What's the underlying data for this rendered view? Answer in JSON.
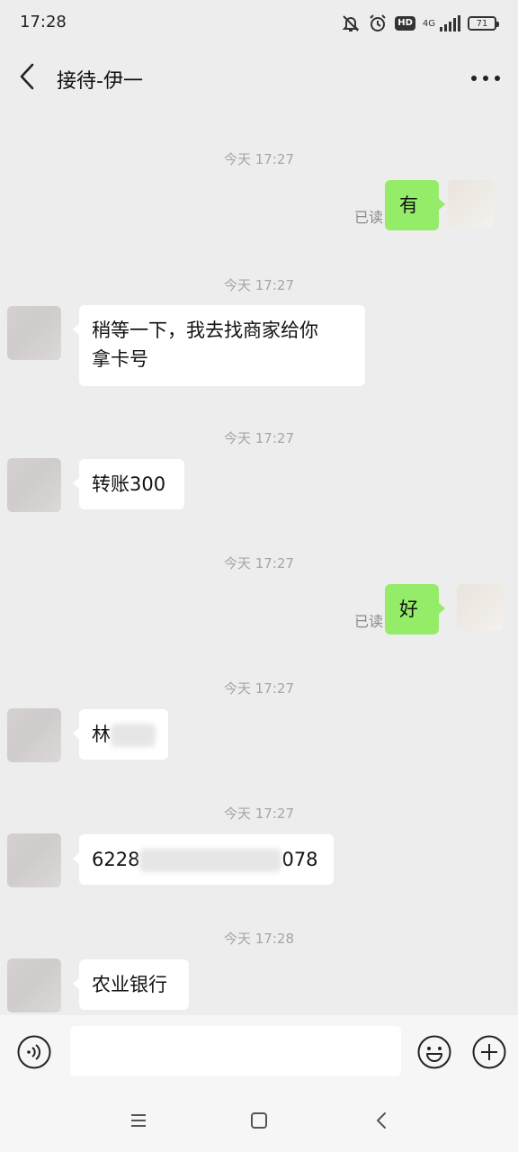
{
  "status_bar": {
    "time": "17:28",
    "network": "4G",
    "battery": "71",
    "icons": [
      "mute-icon",
      "alarm-icon",
      "hd-icon",
      "signal-icon",
      "battery-icon"
    ]
  },
  "header": {
    "title": "接待-伊一",
    "back_icon": "chevron-left-icon",
    "more_icon": "more-dots-icon"
  },
  "messages": [
    {
      "time": "今天 17:27",
      "side": "right",
      "text": "有",
      "read": "已读"
    },
    {
      "time": "今天 17:27",
      "side": "left",
      "line1": "稍等一下，我去找商家给你",
      "line2": "拿卡号"
    },
    {
      "time": "今天 17:27",
      "side": "left",
      "text": "转账300"
    },
    {
      "time": "今天 17:27",
      "side": "right",
      "text": "好",
      "read": "已读"
    },
    {
      "time": "今天 17:27",
      "side": "left",
      "text": "林"
    },
    {
      "time": "今天 17:27",
      "side": "left",
      "text_start": "6228",
      "text_end": "078"
    },
    {
      "time": "今天 17:28",
      "side": "left",
      "text": "农业银行"
    }
  ],
  "input_bar": {
    "value": "",
    "voice_icon": "voice-icon",
    "emoji_icon": "emoji-icon",
    "plus_icon": "plus-icon"
  },
  "system_nav": {
    "icons": [
      "menu-icon",
      "home-icon",
      "back-icon"
    ]
  },
  "colors": {
    "background": "#ededed",
    "sent_bubble": "#95ec69",
    "received_bubble": "#ffffff",
    "timestamp": "#a5a5a5"
  }
}
